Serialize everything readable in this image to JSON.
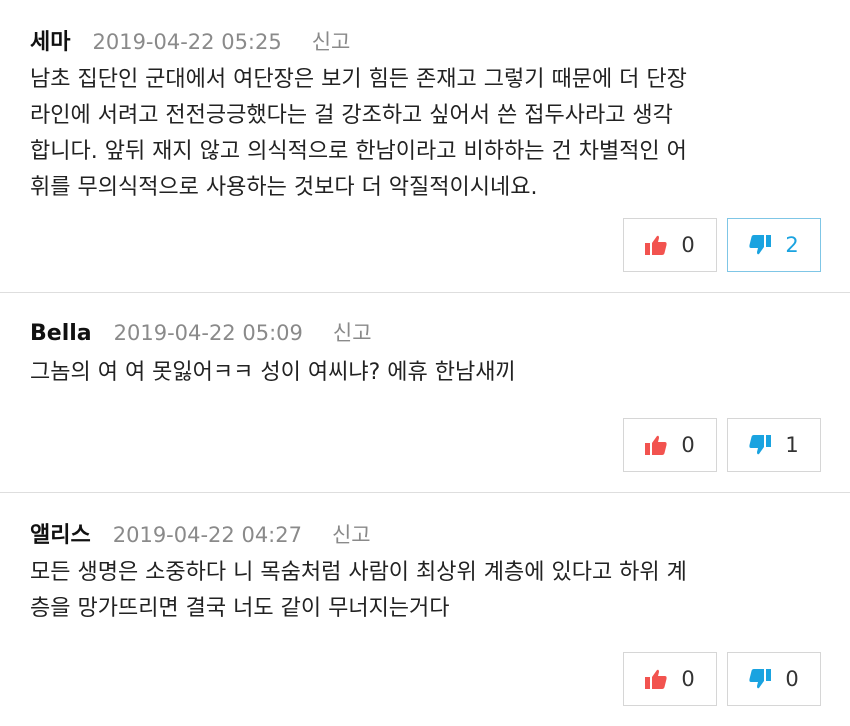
{
  "colors": {
    "like": "#f2534f",
    "dislike": "#1aa3e0",
    "active_border": "#7fc6e6"
  },
  "comments": [
    {
      "author": "세마",
      "date": "2019-04-22 05:25",
      "report": "신고",
      "body": "남초 집단인 군대에서 여단장은 보기 힘든 존재고 그렇기 때문에 더 단장\n라인에 서려고 전전긍긍했다는 걸 강조하고 싶어서 쓴 접두사라고 생각\n합니다. 앞뒤 재지 않고 의식적으로 한남이라고 비하하는 건 차별적인 어\n휘를 무의식적으로 사용하는 것보다 더 악질적이시네요.",
      "likes": "0",
      "dislikes": "2",
      "like_icon": "thumbs-up-icon",
      "dislike_icon": "thumbs-down-icon"
    },
    {
      "author": "Bella",
      "date": "2019-04-22 05:09",
      "report": "신고",
      "body": "그놈의 여 여 못잃어ㅋㅋ 성이 여씨냐? 에휴 한남새끼",
      "likes": "0",
      "dislikes": "1",
      "like_icon": "thumbs-up-icon",
      "dislike_icon": "thumbs-down-icon"
    },
    {
      "author": "앨리스",
      "date": "2019-04-22 04:27",
      "report": "신고",
      "body": "모든 생명은 소중하다 니 목숨처럼 사람이 최상위 계층에 있다고 하위 계\n층을 망가뜨리면 결국 너도 같이 무너지는거다",
      "likes": "0",
      "dislikes": "0",
      "like_icon": "thumbs-up-icon",
      "dislike_icon": "thumbs-down-icon"
    }
  ]
}
